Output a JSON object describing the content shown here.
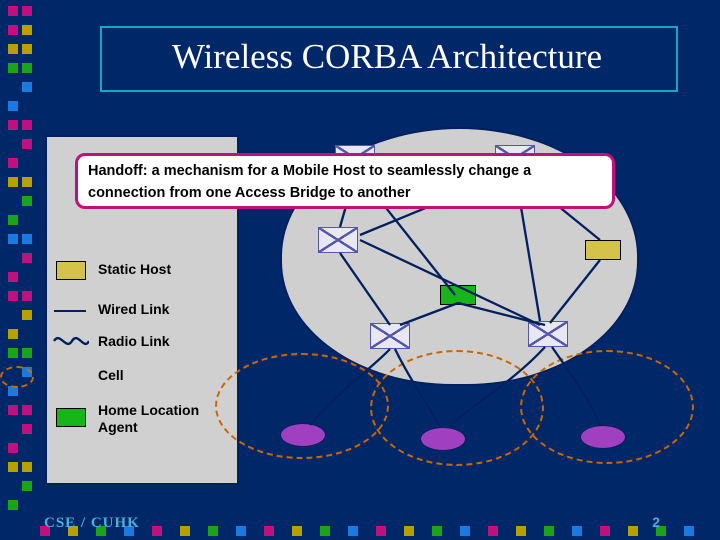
{
  "title": "Wireless CORBA Architecture",
  "callout": "Handoff: a mechanism for a Mobile Host to seamlessly change a connection from one Access Bridge to another",
  "legend": {
    "static_host": "Static Host",
    "wired_link": "Wired Link",
    "radio_link": "Radio Link",
    "cell": "Cell",
    "hla": "Home Location Agent"
  },
  "footer": {
    "logo": "CSE / CUHK",
    "page": "2"
  },
  "decor_colors": [
    "#c01080",
    "#c01080",
    "#c01080",
    "#b8a000",
    "#b8a000",
    "#b8a000",
    "#19a419",
    "#19a419",
    "#19a419",
    "#1a7ae0",
    "#1a7ae0",
    "#1a7ae0",
    "#c01080",
    "#c01080",
    "#c01080"
  ]
}
